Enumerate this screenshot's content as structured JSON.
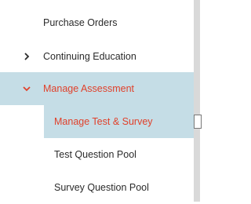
{
  "sidebar": {
    "items": [
      {
        "label": "Purchase Orders",
        "icon": ""
      },
      {
        "label": "Continuing Education",
        "icon": "chevron-right-icon"
      },
      {
        "label": "Manage Assessment",
        "icon": "chevron-down-icon",
        "active": true
      },
      {
        "label": "Manage Test & Survey",
        "active": true
      },
      {
        "label": "Test Question Pool"
      },
      {
        "label": "Survey Question Pool"
      }
    ]
  },
  "colors": {
    "active_bg": "#c5dde6",
    "active_text": "#e0412b",
    "text": "#2b2b2b"
  }
}
